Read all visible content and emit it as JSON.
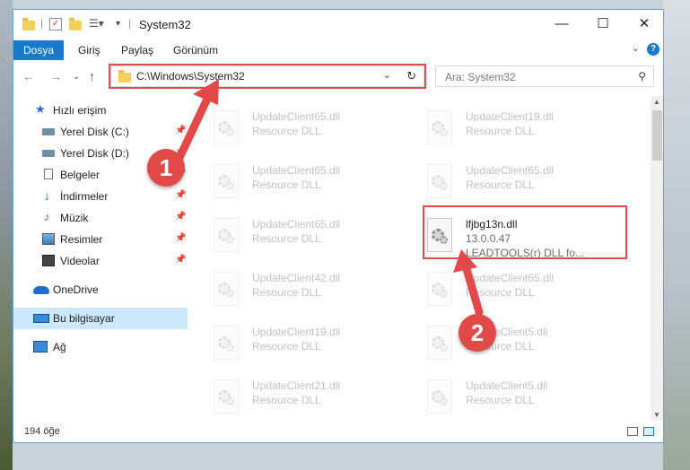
{
  "window": {
    "title": "System32"
  },
  "ribbon": {
    "tabs": [
      "Dosya",
      "Giriş",
      "Paylaş",
      "Görünüm"
    ],
    "help_label": "?"
  },
  "address": {
    "path": "C:\\Windows\\System32",
    "search_placeholder": "Ara: System32"
  },
  "sidebar": {
    "items": [
      {
        "label": "Hızlı erişim",
        "icon": "star-icon",
        "pinned": false
      },
      {
        "label": "Yerel Disk (C:)",
        "icon": "drive-icon",
        "pinned": true
      },
      {
        "label": "Yerel Disk (D:)",
        "icon": "drive-icon",
        "pinned": true
      },
      {
        "label": "Belgeler",
        "icon": "document-icon",
        "pinned": true
      },
      {
        "label": "İndirmeler",
        "icon": "download-icon",
        "pinned": true
      },
      {
        "label": "Müzik",
        "icon": "music-icon",
        "pinned": true
      },
      {
        "label": "Resimler",
        "icon": "pictures-icon",
        "pinned": true
      },
      {
        "label": "Videolar",
        "icon": "video-icon",
        "pinned": true
      },
      {
        "label": "OneDrive",
        "icon": "cloud-icon",
        "pinned": false
      },
      {
        "label": "Bu bilgisayar",
        "icon": "computer-icon",
        "pinned": false,
        "selected": true
      },
      {
        "label": "Ağ",
        "icon": "network-icon",
        "pinned": false
      }
    ]
  },
  "files": {
    "left_column": [
      {
        "name": "UpdateClient65.dll",
        "type": "Resource DLL"
      },
      {
        "name": "UpdateClient65.dll",
        "type": "Resource DLL"
      },
      {
        "name": "UpdateClient65.dll",
        "type": "Resource DLL"
      },
      {
        "name": "UpdateClient42.dll",
        "type": "Resource DLL"
      },
      {
        "name": "UpdateClient19.dll",
        "type": "Resource DLL"
      },
      {
        "name": "UpdateClient21.dll",
        "type": "Resource DLL"
      }
    ],
    "right_column": [
      {
        "name": "UpdateClient19.dll",
        "type": "Resource DLL"
      },
      {
        "name": "UpdateClient65.dll",
        "type": "Resource DLL"
      },
      {
        "name": "lfjbg13n.dll",
        "type": "13.0.0.47",
        "desc": "LEADTOOLS(r) DLL fo...",
        "highlighted": true
      },
      {
        "name": "UpdateClient65.dll",
        "type": "Resource DLL"
      },
      {
        "name": "UpdateClient5.dll",
        "type": "Resource DLL"
      },
      {
        "name": "UpdateClient5.dll",
        "type": "Resource DLL"
      }
    ]
  },
  "status": {
    "count": "194 öğe"
  },
  "callouts": {
    "one": "1",
    "two": "2",
    "color": "#e24a4a"
  }
}
